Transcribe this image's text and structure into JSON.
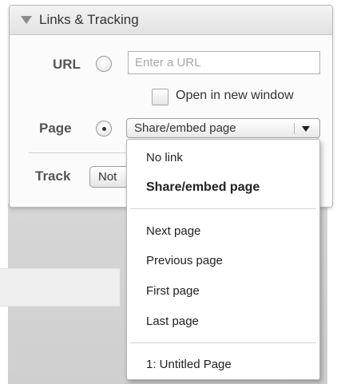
{
  "panel": {
    "title": "Links & Tracking"
  },
  "url_row": {
    "label": "URL",
    "input_value": "",
    "input_placeholder": "Enter a URL",
    "selected": false
  },
  "new_window": {
    "label": "Open in new window",
    "checked": false
  },
  "page_row": {
    "label": "Page",
    "selected": true,
    "select_value": "Share/embed page"
  },
  "track_row": {
    "label": "Track",
    "button_value": "Not"
  },
  "menu": {
    "items": [
      {
        "label": "No link",
        "selected": false
      },
      {
        "label": "Share/embed page",
        "selected": true
      },
      {
        "label": "Next page",
        "selected": false
      },
      {
        "label": "Previous page",
        "selected": false
      },
      {
        "label": "First page",
        "selected": false
      },
      {
        "label": "Last page",
        "selected": false
      },
      {
        "label": "1: Untitled Page",
        "selected": false
      }
    ]
  }
}
